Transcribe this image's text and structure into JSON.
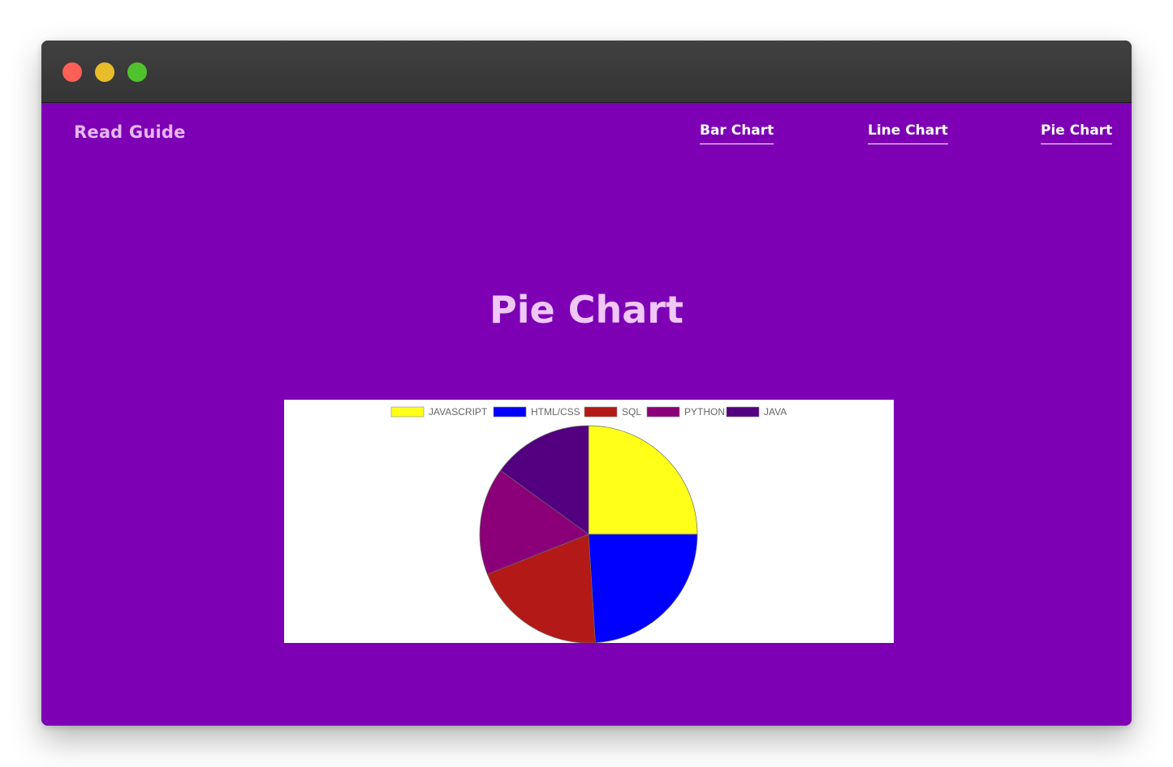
{
  "window": {
    "traffic_lights": {
      "close_color": "#fe5f57",
      "minimize_color": "#e8bd2b",
      "zoom_color": "#50c22e"
    }
  },
  "nav": {
    "brand": "Read Guide",
    "links": [
      "Bar Chart",
      "Line Chart",
      "Pie Chart"
    ]
  },
  "main": {
    "title": "Pie Chart"
  },
  "colors": {
    "page_background": "#7d00b5",
    "brand_text": "#e8b7f2",
    "title_text": "#efc8f7"
  },
  "chart_data": {
    "type": "pie",
    "categories": [
      "JAVASCRIPT",
      "HTML/CSS",
      "SQL",
      "PYTHON",
      "JAVA"
    ],
    "values": [
      25,
      24,
      20,
      16,
      15
    ],
    "colors": [
      "#ffff1a",
      "#0000ff",
      "#b31a17",
      "#8b0078",
      "#520080"
    ],
    "legend_position": "top"
  }
}
